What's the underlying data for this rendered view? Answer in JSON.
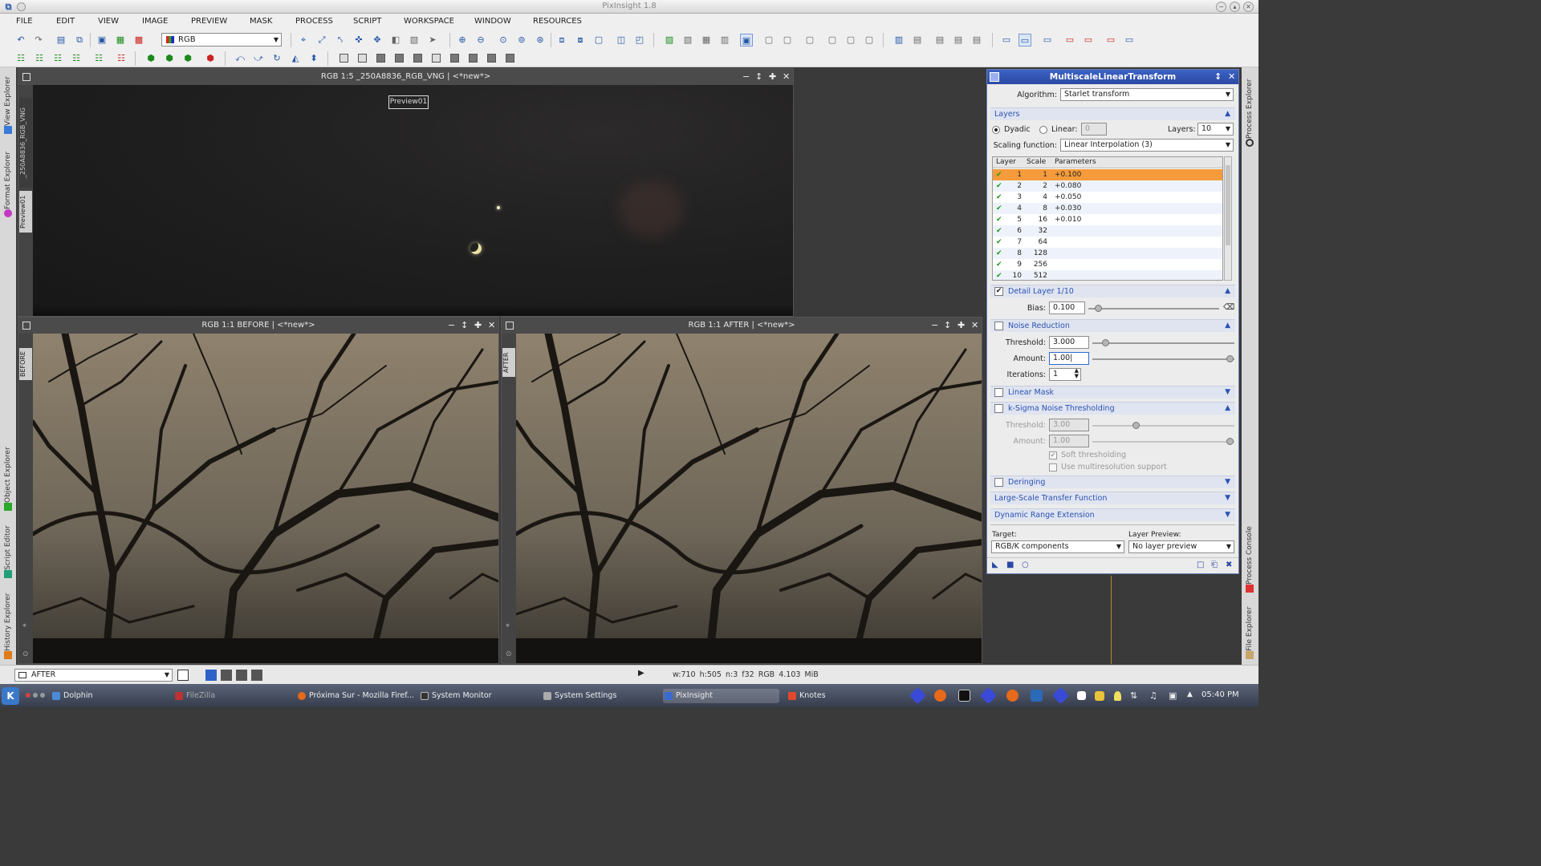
{
  "app": {
    "title": "PixInsight 1.8",
    "window_buttons": [
      "−",
      "▴",
      "✕"
    ]
  },
  "menu": [
    "FILE",
    "EDIT",
    "VIEW",
    "IMAGE",
    "PREVIEW",
    "MASK",
    "PROCESS",
    "SCRIPT",
    "WORKSPACE",
    "WINDOW",
    "RESOURCES"
  ],
  "toolbar": {
    "color_space": "RGB"
  },
  "left_tabs": {
    "view_explorer": "View Explorer",
    "format_explorer": "Format Explorer",
    "object_explorer": "Object Explorer",
    "script_editor": "Script Editor",
    "history_explorer": "History Explorer"
  },
  "right_tabs": {
    "process_explorer": "Process Explorer",
    "process_console": "Process Console",
    "file_explorer": "File Explorer"
  },
  "windows": {
    "main": {
      "title": "RGB 1:5 _250A8836_RGB_VNG | <*new*>",
      "side_labels": [
        "_250A8836_RGB_VNG",
        "Preview01"
      ],
      "preview_box_label": "Preview01"
    },
    "before": {
      "title": "RGB 1:1 BEFORE | <*new*>",
      "side_label": "BEFORE"
    },
    "after": {
      "title": "RGB 1:1 AFTER | <*new*>",
      "side_label": "AFTER"
    },
    "controls": [
      "−",
      "↕",
      "✚",
      "✕"
    ]
  },
  "mlt": {
    "title": "MultiscaleLinearTransform",
    "algorithm_label": "Algorithm:",
    "algorithm_value": "Starlet transform",
    "layers_section": "Layers",
    "dyadic_label": "Dyadic",
    "linear_label": "Linear:",
    "linear_value": "0",
    "layers_label": "Layers:",
    "layers_value": "10",
    "scaling_label": "Scaling function:",
    "scaling_value": "Linear Interpolation (3)",
    "table_headers": [
      "Layer",
      "Scale",
      "Parameters"
    ],
    "table_rows": [
      {
        "layer": "1",
        "scale": "1",
        "params": "+0.100",
        "selected": true
      },
      {
        "layer": "2",
        "scale": "2",
        "params": "+0.080"
      },
      {
        "layer": "3",
        "scale": "4",
        "params": "+0.050"
      },
      {
        "layer": "4",
        "scale": "8",
        "params": "+0.030"
      },
      {
        "layer": "5",
        "scale": "16",
        "params": "+0.010"
      },
      {
        "layer": "6",
        "scale": "32",
        "params": ""
      },
      {
        "layer": "7",
        "scale": "64",
        "params": ""
      },
      {
        "layer": "8",
        "scale": "128",
        "params": ""
      },
      {
        "layer": "9",
        "scale": "256",
        "params": ""
      },
      {
        "layer": "10",
        "scale": "512",
        "params": ""
      }
    ],
    "detail_section": "Detail Layer 1/10",
    "bias_label": "Bias:",
    "bias_value": "0.100",
    "noise_section": "Noise Reduction",
    "threshold_label": "Threshold:",
    "threshold_value": "3.000",
    "amount_label": "Amount:",
    "amount_value": "1.00|",
    "iterations_label": "Iterations:",
    "iterations_value": "1",
    "linear_mask_section": "Linear Mask",
    "ksigma_section": "k-Sigma Noise Thresholding",
    "ks_threshold_label": "Threshold:",
    "ks_threshold_value": "3.00",
    "ks_amount_label": "Amount:",
    "ks_amount_value": "1.00",
    "soft_thresholding": "Soft thresholding",
    "multires_support": "Use multiresolution support",
    "deringing_section": "Deringing",
    "lstf_section": "Large-Scale Transfer Function",
    "dre_section": "Dynamic Range Extension",
    "target_label": "Target:",
    "target_value": "RGB/K components",
    "layer_preview_label": "Layer Preview:",
    "layer_preview_value": "No layer preview"
  },
  "bottom": {
    "view_value": "AFTER",
    "status": "w:710   h:505   n:3   f32   RGB   4.103 MiB"
  },
  "taskbar": {
    "tasks": [
      "Dolphin",
      "FileZilla",
      "Próxima Sur - Mozilla Firef...",
      "System Monitor",
      "System Settings",
      "PixInsight",
      "Knotes"
    ],
    "clock": "05:40 PM"
  },
  "colors": {
    "accent": "#2a49a3",
    "selected_row": "#f59b3b",
    "check_green": "#1a9a1a"
  }
}
